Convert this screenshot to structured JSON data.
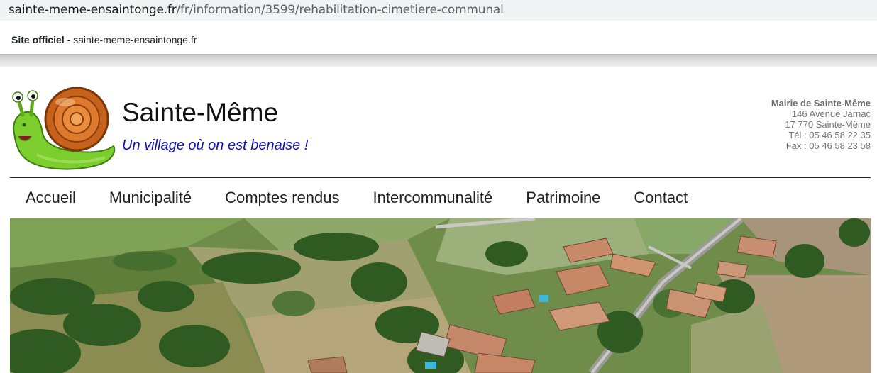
{
  "browser": {
    "url_domain": "sainte-meme-ensaintonge.fr",
    "url_path": "/fr/information/3599/rehabilitation-cimetiere-communal"
  },
  "official_bar": {
    "label": "Site officiel",
    "separator": " - ",
    "domain": "sainte-meme-ensaintonge.fr"
  },
  "header": {
    "title": "Sainte-Même",
    "slogan": "Un village où on est benaise !",
    "logo_icon": "snail-icon"
  },
  "contact": {
    "name": "Mairie de Sainte-Même",
    "address": "146 Avenue Jarnac",
    "city": "17 770 Sainte-Même",
    "phone": "Tél : 05 46 58 22 35",
    "fax": "Fax : 05 46 58 23 58"
  },
  "nav": {
    "items": [
      {
        "label": "Accueil"
      },
      {
        "label": "Municipalité"
      },
      {
        "label": "Comptes rendus"
      },
      {
        "label": "Intercommunalité"
      },
      {
        "label": "Patrimoine"
      },
      {
        "label": "Contact"
      }
    ]
  },
  "colors": {
    "slogan": "#1111bb",
    "address_bar": "#f1f3f4",
    "rule": "#222222"
  }
}
